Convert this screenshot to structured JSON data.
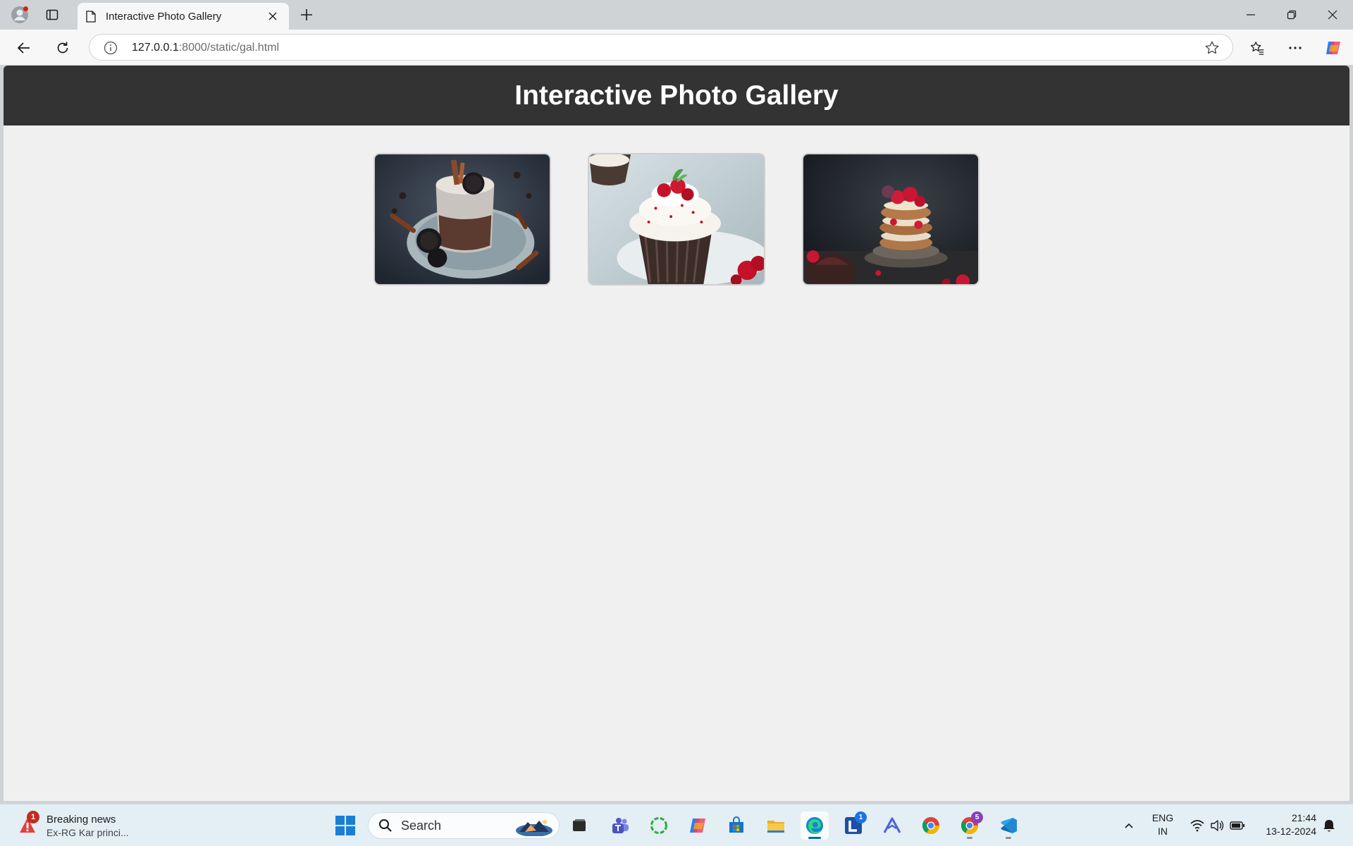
{
  "browser": {
    "tab": {
      "title": "Interactive Photo Gallery"
    },
    "address": {
      "host": "127.0.0.1",
      "path": ":8000/static/gal.html"
    }
  },
  "page": {
    "title": "Interactive Photo Gallery",
    "photos": [
      {
        "subject": "cookies-and-cream-drink"
      },
      {
        "subject": "red-velvet-cupcake"
      },
      {
        "subject": "raspberry-cookie-stack"
      }
    ]
  },
  "taskbar": {
    "news": {
      "badge": "1",
      "title": "Breaking news",
      "subtitle": "Ex-RG Kar princi..."
    },
    "search_placeholder": "Search",
    "apps": [
      {
        "name": "task-view-icon"
      },
      {
        "name": "teams-icon"
      },
      {
        "name": "refresh-circle-app-icon"
      },
      {
        "name": "copilot-icon"
      },
      {
        "name": "store-icon"
      },
      {
        "name": "file-explorer-icon"
      },
      {
        "name": "edge-icon",
        "active": true
      },
      {
        "name": "l-app-icon",
        "badge": "1"
      },
      {
        "name": "triangle-app-icon"
      },
      {
        "name": "chrome-icon"
      },
      {
        "name": "chrome-profile-icon",
        "badge": "5"
      },
      {
        "name": "vscode-icon"
      }
    ],
    "language": {
      "line1": "ENG",
      "line2": "IN"
    },
    "clock": {
      "time": "21:44",
      "date": "13-12-2024"
    }
  },
  "colors": {
    "page_header_bg": "#333333",
    "page_bg": "#f0f0f0",
    "chrome_bg": "#cfd3d6",
    "toolbar_bg": "#f7f7f7"
  }
}
